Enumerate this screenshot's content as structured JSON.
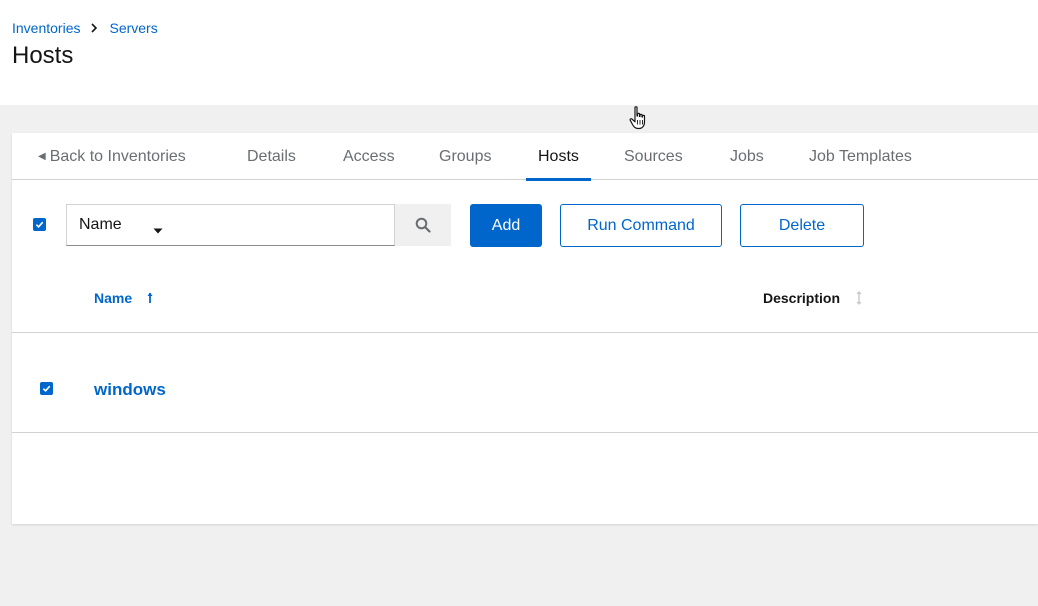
{
  "breadcrumb": {
    "items": [
      "Inventories",
      "Servers"
    ]
  },
  "page": {
    "title": "Hosts"
  },
  "tabs": [
    {
      "label": "Back to Inventories"
    },
    {
      "label": "Details"
    },
    {
      "label": "Access"
    },
    {
      "label": "Groups"
    },
    {
      "label": "Hosts",
      "active": true
    },
    {
      "label": "Sources"
    },
    {
      "label": "Jobs"
    },
    {
      "label": "Job Templates"
    }
  ],
  "toolbar": {
    "filter_field": "Name",
    "search_value": "",
    "add_label": "Add",
    "run_command_label": "Run Command",
    "delete_label": "Delete"
  },
  "table": {
    "columns": [
      {
        "label": "Name",
        "sort": "ascending"
      },
      {
        "label": "Description"
      }
    ],
    "rows": [
      {
        "name": "windows",
        "description": "",
        "selected": true
      }
    ]
  },
  "colors": {
    "accent": "#0066cc",
    "text": "#151515",
    "muted": "#6a6e73",
    "border": "#d2d2d2",
    "background": "#f0f0f0"
  },
  "icons": {
    "breadcrumb_separator": "chevron-right-icon",
    "back_caret": "caret-left-icon",
    "select_caret": "caret-down-icon",
    "search": "search-icon",
    "sort_name": "long-arrow-up-icon",
    "sort_description": "sort-icon",
    "cursor": "hand-pointer-icon"
  }
}
